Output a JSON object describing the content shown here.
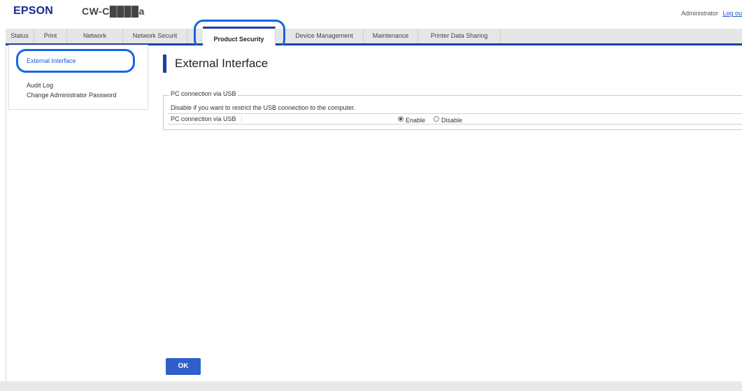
{
  "header": {
    "brand": "EPSON",
    "model": "CW-C████a",
    "user": "Administrator",
    "logout": "Log ou"
  },
  "tabs": [
    {
      "label": "Status"
    },
    {
      "label": "Print"
    },
    {
      "label": "Network"
    },
    {
      "label": "Network Securit"
    },
    {
      "label": "Product Security",
      "active": true
    },
    {
      "label": "Device Management"
    },
    {
      "label": "Maintenance"
    },
    {
      "label": "Printer Data Sharing"
    }
  ],
  "sidebar": {
    "items": [
      {
        "label": "External Interface",
        "active": true
      },
      {
        "label": "Audit Log"
      },
      {
        "label": "Change Administrator Password"
      }
    ]
  },
  "main": {
    "title": "External Interface",
    "section_legend": "PC connection via USB",
    "description": "Disable if you want to restrict the USB connection to the computer.",
    "row_label": "PC connection via USB",
    "options": [
      {
        "label": "Enable",
        "checked": true
      },
      {
        "label": "Disable",
        "checked": false
      }
    ],
    "ok_label": "OK"
  },
  "colors": {
    "accent": "#1d3f9e",
    "highlight": "#1565e8",
    "button": "#2f5fc9",
    "link": "#1a56d8"
  }
}
